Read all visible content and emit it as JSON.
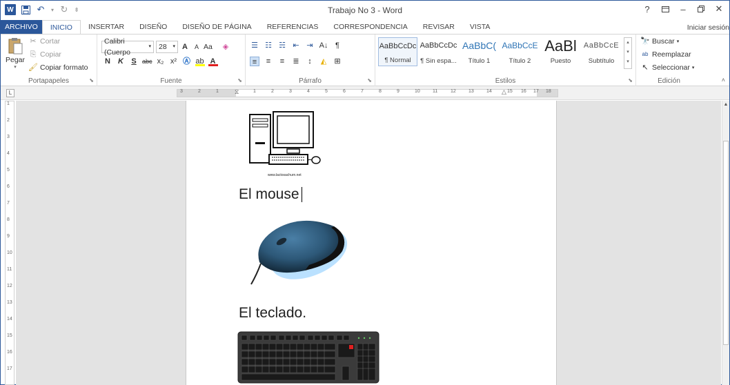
{
  "window": {
    "title": "Trabajo No 3 - Word",
    "help": "?",
    "signin": "Iniciar sesión"
  },
  "qat": {
    "logo": "W"
  },
  "tabs": [
    "ARCHIVO",
    "INICIO",
    "INSERTAR",
    "DISEÑO",
    "DISEÑO DE PÁGINA",
    "REFERENCIAS",
    "CORRESPONDENCIA",
    "REVISAR",
    "VISTA"
  ],
  "clipboard": {
    "paste": "Pegar",
    "cut": "Cortar",
    "copy": "Copiar",
    "format_painter": "Copiar formato",
    "label": "Portapapeles"
  },
  "font": {
    "name": "Calibri (Cuerpo",
    "size": "28",
    "label": "Fuente",
    "bold": "N",
    "italic": "K",
    "underline": "S",
    "strike": "abc",
    "sub": "x₂",
    "sup": "x²",
    "case": "Aa",
    "grow": "A",
    "shrink": "A"
  },
  "paragraph": {
    "label": "Párrafo",
    "sort": "A↓",
    "marks": "¶"
  },
  "styles": {
    "label": "Estilos",
    "items": [
      {
        "preview": "AaBbCcDc",
        "name": "¶ Normal"
      },
      {
        "preview": "AaBbCcDc",
        "name": "¶ Sin espa..."
      },
      {
        "preview": "AaBbC(",
        "name": "Título 1"
      },
      {
        "preview": "AaBbCcE",
        "name": "Título 2"
      },
      {
        "preview": "AaBl",
        "name": "Puesto"
      },
      {
        "preview": "AaBbCcE",
        "name": "Subtítulo"
      }
    ]
  },
  "editing": {
    "find": "Buscar",
    "replace": "Reemplazar",
    "select": "Seleccionar",
    "label": "Edición"
  },
  "ruler": {
    "h_ticks": [
      "3",
      "2",
      "1",
      "1",
      "2",
      "3",
      "4",
      "5",
      "6",
      "7",
      "8",
      "9",
      "10",
      "11",
      "12",
      "13",
      "14",
      "15",
      "16",
      "17",
      "18"
    ],
    "v_ticks": [
      "1",
      "2",
      "3",
      "4",
      "5",
      "6",
      "7",
      "8",
      "9",
      "10",
      "11",
      "12",
      "13",
      "14",
      "15",
      "16",
      "17"
    ]
  },
  "document": {
    "caption_url": "www.lactosachurn.net",
    "heading_mouse": "El mouse",
    "heading_keyboard": "El teclado."
  },
  "colors": {
    "accent": "#2b579a",
    "mouse_body": "#2d5878",
    "glow": "#3aa8ff"
  }
}
